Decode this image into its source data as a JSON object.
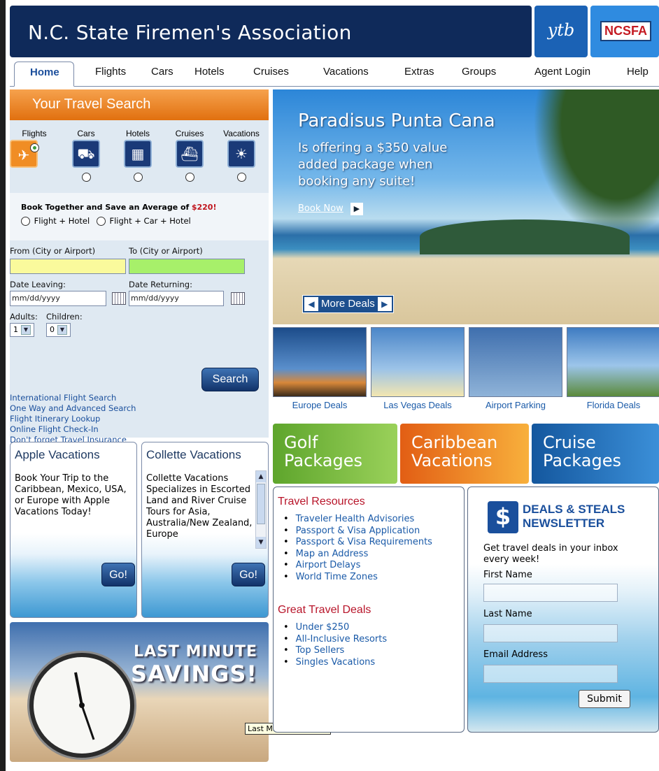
{
  "header": {
    "title": "N.C. State Firemen's Association",
    "logo_ytb": "ytb",
    "logo_ncsfa": "NCSFA"
  },
  "nav": [
    "Home",
    "Flights",
    "Cars",
    "Hotels",
    "Cruises",
    "Vacations",
    "Extras",
    "Groups",
    "Agent Login",
    "Help"
  ],
  "search": {
    "title": "Your Travel Search",
    "types": [
      "Flights",
      "Cars",
      "Hotels",
      "Cruises",
      "Vacations"
    ],
    "selected_type": "Flights",
    "bundle_text": "Book Together and Save an Average of",
    "bundle_amount": "$220!",
    "bundle_opt1": "Flight + Hotel",
    "bundle_opt2": "Flight + Car + Hotel",
    "from_label": "From (City or Airport)",
    "to_label": "To (City or Airport)",
    "leaving_label": "Date Leaving:",
    "returning_label": "Date Returning:",
    "leaving_value": "mm/dd/yyyy",
    "returning_value": "mm/dd/yyyy",
    "adults_label": "Adults:",
    "children_label": "Children:",
    "adults_value": "1",
    "children_value": "0",
    "search_button": "Search",
    "links": [
      "International Flight Search",
      "One Way and Advanced Search",
      "Flight Itinerary Lookup",
      "Online Flight Check-In",
      "Don't forget Travel Insurance"
    ]
  },
  "promo_apple": {
    "title": "Apple Vacations",
    "text": "Book Your Trip to the Caribbean, Mexico, USA, or Europe with Apple Vacations Today!",
    "go": "Go!"
  },
  "promo_collette": {
    "title": "Collette Vacations",
    "text": "Collette Vacations Specializes in Escorted Land and River Cruise Tours for Asia, Australia/New Zealand, Europe",
    "go": "Go!"
  },
  "lastmin": {
    "line1": "LAST MINUTE",
    "line2": "SAVINGS!",
    "tooltip": "Last Minute Savings!"
  },
  "hero": {
    "title": "Paradisus Punta Cana",
    "subtitle": "Is offering a $350 value added package when booking any suite!",
    "book_now": "Book Now",
    "more_deals": "More Deals"
  },
  "deals": [
    "Europe Deals",
    "Las Vegas Deals",
    "Airport Parking",
    "Florida Deals"
  ],
  "packages": [
    {
      "line1": "Golf",
      "line2": "Packages",
      "color": "#6fae2e"
    },
    {
      "line1": "Caribbean",
      "line2": "Vacations",
      "color": "#f07b1d"
    },
    {
      "line1": "Cruise",
      "line2": "Packages",
      "color": "#1a65b0"
    }
  ],
  "resources": {
    "title1": "Travel Resources",
    "items1": [
      "Traveler Health Advisories",
      "Passport & Visa Application",
      "Passport & Visa Requirements",
      "Map an Address",
      "Airport Delays",
      "World Time Zones"
    ],
    "title2": "Great Travel Deals",
    "items2": [
      "Under $250",
      "All-Inclusive Resorts",
      "Top Sellers",
      "Singles Vacations"
    ]
  },
  "newsletter": {
    "title1": "DEALS & STEALS",
    "title2": "NEWSLETTER",
    "intro": "Get travel deals in your inbox every week!",
    "first_name": "First Name",
    "last_name": "Last Name",
    "email": "Email Address",
    "submit": "Submit"
  }
}
